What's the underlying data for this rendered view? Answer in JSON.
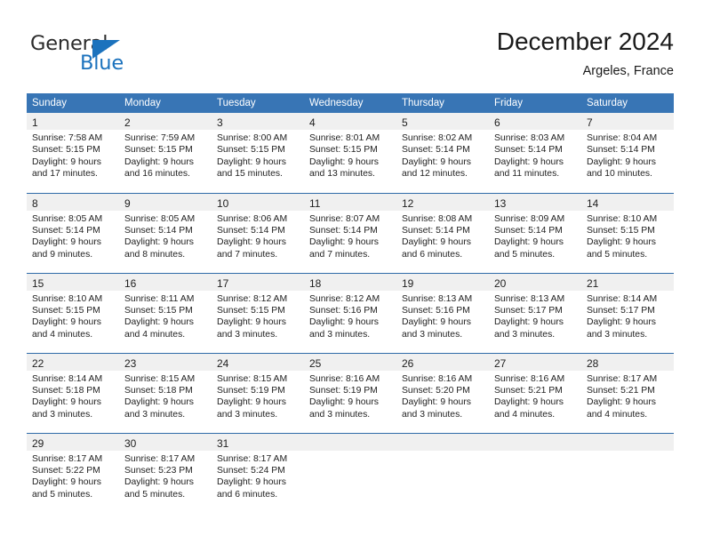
{
  "brand": {
    "name_top": "General",
    "name_bottom": "Blue",
    "accent_color": "#1b72bd",
    "top_color": "#2b2b2b"
  },
  "header": {
    "title": "December 2024",
    "subtitle": "Argeles, France"
  },
  "theme": {
    "header_row_bg": "#3875b5",
    "header_row_text": "#ffffff",
    "daynum_bg": "#f0f0f0",
    "row_border": "#2f6ba8"
  },
  "weekday_headers": [
    "Sunday",
    "Monday",
    "Tuesday",
    "Wednesday",
    "Thursday",
    "Friday",
    "Saturday"
  ],
  "weeks": [
    [
      {
        "day": "1",
        "sunrise": "Sunrise: 7:58 AM",
        "sunset": "Sunset: 5:15 PM",
        "daylight1": "Daylight: 9 hours",
        "daylight2": "and 17 minutes."
      },
      {
        "day": "2",
        "sunrise": "Sunrise: 7:59 AM",
        "sunset": "Sunset: 5:15 PM",
        "daylight1": "Daylight: 9 hours",
        "daylight2": "and 16 minutes."
      },
      {
        "day": "3",
        "sunrise": "Sunrise: 8:00 AM",
        "sunset": "Sunset: 5:15 PM",
        "daylight1": "Daylight: 9 hours",
        "daylight2": "and 15 minutes."
      },
      {
        "day": "4",
        "sunrise": "Sunrise: 8:01 AM",
        "sunset": "Sunset: 5:15 PM",
        "daylight1": "Daylight: 9 hours",
        "daylight2": "and 13 minutes."
      },
      {
        "day": "5",
        "sunrise": "Sunrise: 8:02 AM",
        "sunset": "Sunset: 5:14 PM",
        "daylight1": "Daylight: 9 hours",
        "daylight2": "and 12 minutes."
      },
      {
        "day": "6",
        "sunrise": "Sunrise: 8:03 AM",
        "sunset": "Sunset: 5:14 PM",
        "daylight1": "Daylight: 9 hours",
        "daylight2": "and 11 minutes."
      },
      {
        "day": "7",
        "sunrise": "Sunrise: 8:04 AM",
        "sunset": "Sunset: 5:14 PM",
        "daylight1": "Daylight: 9 hours",
        "daylight2": "and 10 minutes."
      }
    ],
    [
      {
        "day": "8",
        "sunrise": "Sunrise: 8:05 AM",
        "sunset": "Sunset: 5:14 PM",
        "daylight1": "Daylight: 9 hours",
        "daylight2": "and 9 minutes."
      },
      {
        "day": "9",
        "sunrise": "Sunrise: 8:05 AM",
        "sunset": "Sunset: 5:14 PM",
        "daylight1": "Daylight: 9 hours",
        "daylight2": "and 8 minutes."
      },
      {
        "day": "10",
        "sunrise": "Sunrise: 8:06 AM",
        "sunset": "Sunset: 5:14 PM",
        "daylight1": "Daylight: 9 hours",
        "daylight2": "and 7 minutes."
      },
      {
        "day": "11",
        "sunrise": "Sunrise: 8:07 AM",
        "sunset": "Sunset: 5:14 PM",
        "daylight1": "Daylight: 9 hours",
        "daylight2": "and 7 minutes."
      },
      {
        "day": "12",
        "sunrise": "Sunrise: 8:08 AM",
        "sunset": "Sunset: 5:14 PM",
        "daylight1": "Daylight: 9 hours",
        "daylight2": "and 6 minutes."
      },
      {
        "day": "13",
        "sunrise": "Sunrise: 8:09 AM",
        "sunset": "Sunset: 5:14 PM",
        "daylight1": "Daylight: 9 hours",
        "daylight2": "and 5 minutes."
      },
      {
        "day": "14",
        "sunrise": "Sunrise: 8:10 AM",
        "sunset": "Sunset: 5:15 PM",
        "daylight1": "Daylight: 9 hours",
        "daylight2": "and 5 minutes."
      }
    ],
    [
      {
        "day": "15",
        "sunrise": "Sunrise: 8:10 AM",
        "sunset": "Sunset: 5:15 PM",
        "daylight1": "Daylight: 9 hours",
        "daylight2": "and 4 minutes."
      },
      {
        "day": "16",
        "sunrise": "Sunrise: 8:11 AM",
        "sunset": "Sunset: 5:15 PM",
        "daylight1": "Daylight: 9 hours",
        "daylight2": "and 4 minutes."
      },
      {
        "day": "17",
        "sunrise": "Sunrise: 8:12 AM",
        "sunset": "Sunset: 5:15 PM",
        "daylight1": "Daylight: 9 hours",
        "daylight2": "and 3 minutes."
      },
      {
        "day": "18",
        "sunrise": "Sunrise: 8:12 AM",
        "sunset": "Sunset: 5:16 PM",
        "daylight1": "Daylight: 9 hours",
        "daylight2": "and 3 minutes."
      },
      {
        "day": "19",
        "sunrise": "Sunrise: 8:13 AM",
        "sunset": "Sunset: 5:16 PM",
        "daylight1": "Daylight: 9 hours",
        "daylight2": "and 3 minutes."
      },
      {
        "day": "20",
        "sunrise": "Sunrise: 8:13 AM",
        "sunset": "Sunset: 5:17 PM",
        "daylight1": "Daylight: 9 hours",
        "daylight2": "and 3 minutes."
      },
      {
        "day": "21",
        "sunrise": "Sunrise: 8:14 AM",
        "sunset": "Sunset: 5:17 PM",
        "daylight1": "Daylight: 9 hours",
        "daylight2": "and 3 minutes."
      }
    ],
    [
      {
        "day": "22",
        "sunrise": "Sunrise: 8:14 AM",
        "sunset": "Sunset: 5:18 PM",
        "daylight1": "Daylight: 9 hours",
        "daylight2": "and 3 minutes."
      },
      {
        "day": "23",
        "sunrise": "Sunrise: 8:15 AM",
        "sunset": "Sunset: 5:18 PM",
        "daylight1": "Daylight: 9 hours",
        "daylight2": "and 3 minutes."
      },
      {
        "day": "24",
        "sunrise": "Sunrise: 8:15 AM",
        "sunset": "Sunset: 5:19 PM",
        "daylight1": "Daylight: 9 hours",
        "daylight2": "and 3 minutes."
      },
      {
        "day": "25",
        "sunrise": "Sunrise: 8:16 AM",
        "sunset": "Sunset: 5:19 PM",
        "daylight1": "Daylight: 9 hours",
        "daylight2": "and 3 minutes."
      },
      {
        "day": "26",
        "sunrise": "Sunrise: 8:16 AM",
        "sunset": "Sunset: 5:20 PM",
        "daylight1": "Daylight: 9 hours",
        "daylight2": "and 3 minutes."
      },
      {
        "day": "27",
        "sunrise": "Sunrise: 8:16 AM",
        "sunset": "Sunset: 5:21 PM",
        "daylight1": "Daylight: 9 hours",
        "daylight2": "and 4 minutes."
      },
      {
        "day": "28",
        "sunrise": "Sunrise: 8:17 AM",
        "sunset": "Sunset: 5:21 PM",
        "daylight1": "Daylight: 9 hours",
        "daylight2": "and 4 minutes."
      }
    ],
    [
      {
        "day": "29",
        "sunrise": "Sunrise: 8:17 AM",
        "sunset": "Sunset: 5:22 PM",
        "daylight1": "Daylight: 9 hours",
        "daylight2": "and 5 minutes."
      },
      {
        "day": "30",
        "sunrise": "Sunrise: 8:17 AM",
        "sunset": "Sunset: 5:23 PM",
        "daylight1": "Daylight: 9 hours",
        "daylight2": "and 5 minutes."
      },
      {
        "day": "31",
        "sunrise": "Sunrise: 8:17 AM",
        "sunset": "Sunset: 5:24 PM",
        "daylight1": "Daylight: 9 hours",
        "daylight2": "and 6 minutes."
      },
      {
        "day": "",
        "sunrise": "",
        "sunset": "",
        "daylight1": "",
        "daylight2": ""
      },
      {
        "day": "",
        "sunrise": "",
        "sunset": "",
        "daylight1": "",
        "daylight2": ""
      },
      {
        "day": "",
        "sunrise": "",
        "sunset": "",
        "daylight1": "",
        "daylight2": ""
      },
      {
        "day": "",
        "sunrise": "",
        "sunset": "",
        "daylight1": "",
        "daylight2": ""
      }
    ]
  ]
}
